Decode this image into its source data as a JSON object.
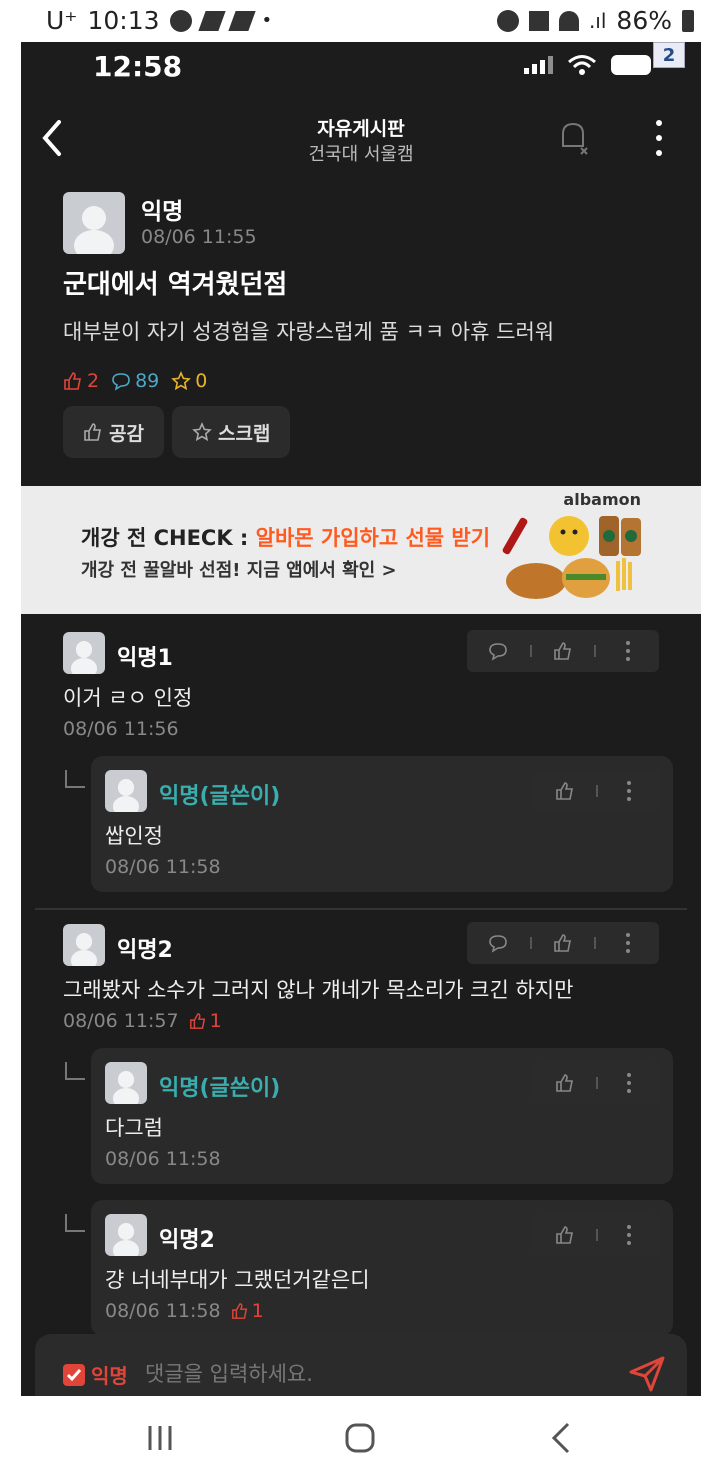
{
  "device_status": {
    "carrier": "U⁺",
    "time": "10:13",
    "battery": "86%"
  },
  "screenshot_status": {
    "time": "12:58",
    "badge": "2"
  },
  "header": {
    "title": "자유게시판",
    "subtitle": "건국대 서울캠"
  },
  "post": {
    "author": "익명",
    "date": "08/06 11:55",
    "title": "군대에서 역겨웠던점",
    "body": "대부분이 자기 성경험을 자랑스럽게 품 ㅋㅋ 아휴 드러워",
    "likes": "2",
    "comments": "89",
    "scraps": "0",
    "like_button": "공감",
    "scrap_button": "스크랩"
  },
  "ad": {
    "brand": "albamon",
    "line1_prefix": "개강 전 CHECK : ",
    "line1_highlight": "알바몬 가입하고 선물 받기",
    "line2": "개강 전 꿀알바 선점! 지금 앱에서 확인 >"
  },
  "comments": [
    {
      "author": "익명1",
      "text": "이거 ㄹㅇ 인정",
      "date": "08/06 11:56"
    },
    {
      "author": "익명(글쓴이)",
      "text": "쌉인정",
      "date": "08/06 11:58"
    },
    {
      "author": "익명2",
      "text": "그래봤자 소수가 그러지 않나 걔네가 목소리가 크긴 하지만",
      "date": "08/06 11:57",
      "likes": "1"
    },
    {
      "author": "익명(글쓴이)",
      "text": "다그럼",
      "date": "08/06 11:58"
    },
    {
      "author": "익명2",
      "text": "걍 너네부대가 그랬던거같은디",
      "date": "08/06 11:58",
      "likes": "1"
    }
  ],
  "input": {
    "anon_label": "익명",
    "placeholder": "댓글을 입력하세요."
  },
  "colors": {
    "background": "#1c1c1c",
    "accent_red": "#e0453a",
    "op_teal": "#3aaeae",
    "star_yellow": "#e8b32a",
    "comment_teal": "#4aa8c8"
  }
}
